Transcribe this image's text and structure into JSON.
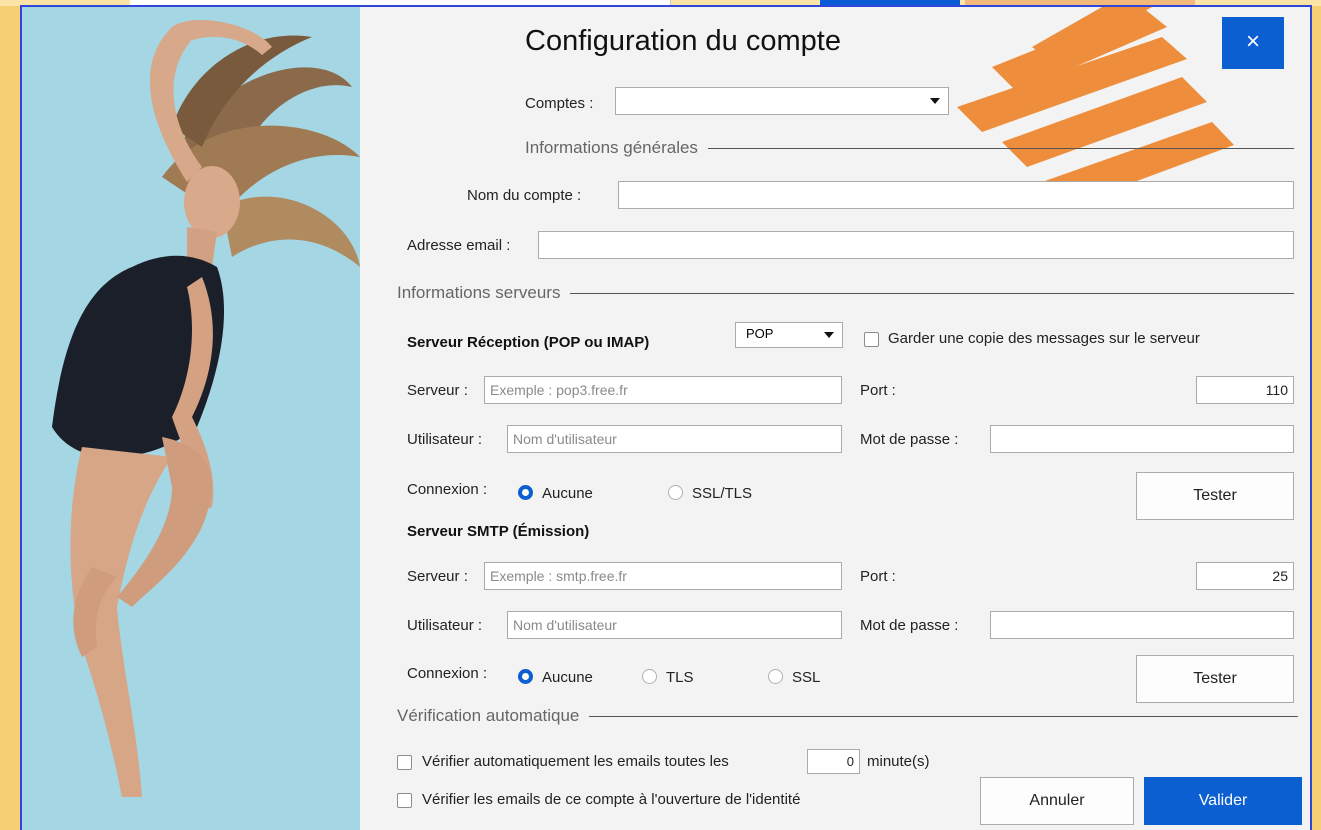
{
  "window": {
    "title": "Configuration du compte",
    "close_label": "×"
  },
  "account": {
    "label": "Comptes :",
    "selected": ""
  },
  "general": {
    "section": "Informations générales",
    "name_label": "Nom du compte :",
    "name_value": "",
    "email_label": "Adresse email :",
    "email_value": ""
  },
  "servers": {
    "section": "Informations serveurs",
    "incoming": {
      "heading": "Serveur Réception (POP ou IMAP)",
      "protocol": "POP",
      "keep_copy_label": "Garder une copie des messages sur le serveur",
      "keep_copy_checked": false,
      "server_label": "Serveur :",
      "server_placeholder": "Exemple : pop3.free.fr",
      "port_label": "Port :",
      "port_value": "110",
      "user_label": "Utilisateur :",
      "user_placeholder": "Nom d'utilisateur",
      "password_label": "Mot de passe :",
      "connection_label": "Connexion :",
      "options": [
        "Aucune",
        "SSL/TLS"
      ],
      "selected": "Aucune",
      "test_label": "Tester"
    },
    "smtp": {
      "heading": "Serveur SMTP (Émission)",
      "server_label": "Serveur :",
      "server_placeholder": "Exemple : smtp.free.fr",
      "port_label": "Port :",
      "port_value": "25",
      "user_label": "Utilisateur :",
      "user_placeholder": "Nom d'utilisateur",
      "password_label": "Mot de passe :",
      "connection_label": "Connexion :",
      "options": [
        "Aucune",
        "TLS",
        "SSL"
      ],
      "selected": "Aucune",
      "test_label": "Tester"
    }
  },
  "auto": {
    "section": "Vérification automatique",
    "auto_check_label": "Vérifier automatiquement les emails toutes les",
    "interval_value": "0",
    "interval_unit": "minute(s)",
    "on_open_label": "Vérifier les emails de ce compte à l'ouverture de l'identité"
  },
  "footer": {
    "cancel_label": "Annuler",
    "ok_label": "Valider"
  },
  "colors": {
    "accent": "#0b5fd1",
    "dialog_bg": "#f3f3f3",
    "photo_bg": "#a4d6e4",
    "deco_orange": "#ee8e3c",
    "app_bg": "#f7cf73"
  }
}
